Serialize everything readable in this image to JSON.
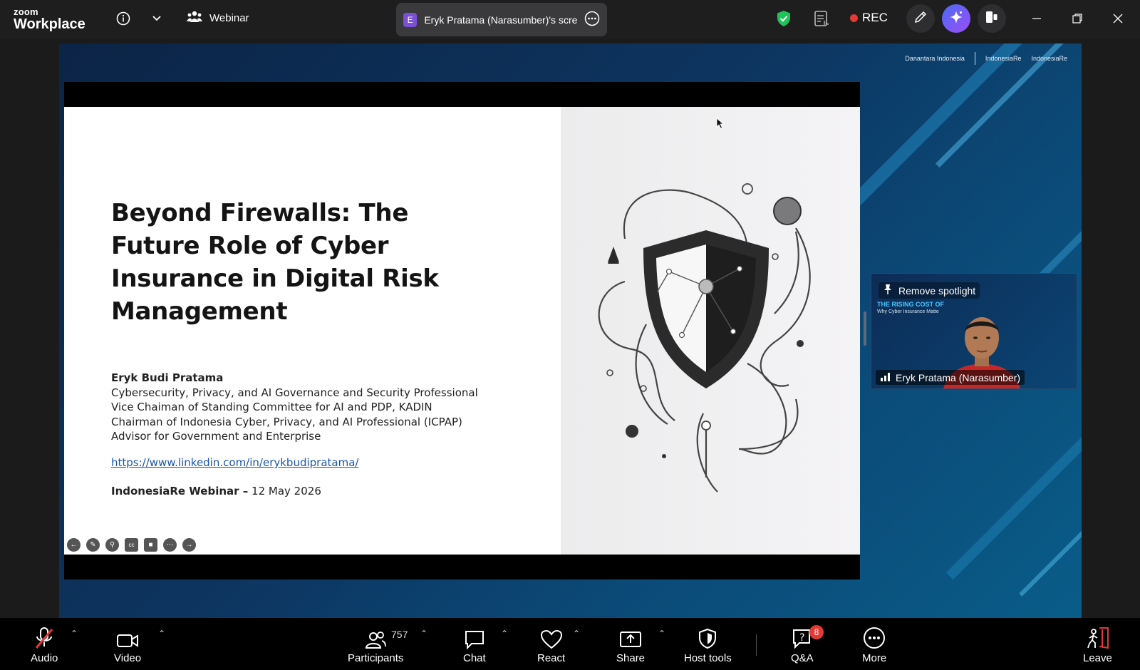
{
  "app": {
    "logo_top": "zoom",
    "logo_bottom": "Workplace",
    "meeting_type": "Webinar"
  },
  "share_indicator": {
    "badge_letter": "E",
    "label": "Eryk Pratama (Narasumber)'s scre"
  },
  "recording": {
    "label": "REC"
  },
  "slide": {
    "title": "Beyond Firewalls: The Future Role of Cyber Insurance in Digital Risk Management",
    "presenter_name": "Eryk Budi Pratama",
    "roles": [
      "Cybersecurity, Privacy, and AI Governance and Security Professional",
      "Vice Chaiman of Standing Committee for AI and PDP, KADIN",
      "Chairman of Indonesia Cyber, Privacy, and AI Professional (ICPAP)",
      "Advisor for Government and Enterprise"
    ],
    "link": "https://www.linkedin.com/in/erykbudipratama/",
    "event_bold": "IndonesiaRe Webinar –",
    "event_date": " 12 May 2026"
  },
  "brand": {
    "logo1": "Danantara Indonesia",
    "logo2": "IndonesiaRe",
    "logo3": "IndonesiaRe"
  },
  "video_tile": {
    "spotlight_label": "Remove spotlight",
    "participant_name": "Eryk Pratama (Narasumber)",
    "bg_title": "THE RISING COST OF",
    "bg_subtitle": "Why Cyber Insurance Matte"
  },
  "toolbar": {
    "audio": "Audio",
    "video": "Video",
    "participants": "Participants",
    "participants_count": "757",
    "chat": "Chat",
    "react": "React",
    "share": "Share",
    "host_tools": "Host tools",
    "qa": "Q&A",
    "qa_badge": "8",
    "more": "More",
    "leave": "Leave"
  },
  "colors": {
    "accent_blue": "#0b5cff",
    "record_red": "#e53935",
    "security_green": "#1fc35a"
  }
}
